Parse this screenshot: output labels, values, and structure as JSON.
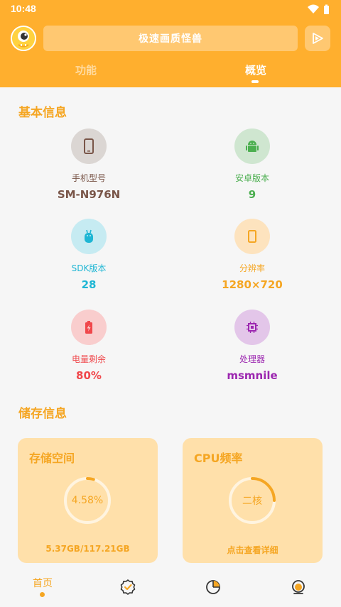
{
  "statusbar": {
    "time": "10:48"
  },
  "header": {
    "title": "极速画质怪兽",
    "tabs": [
      {
        "label": "功能",
        "active": false
      },
      {
        "label": "概览",
        "active": true
      }
    ]
  },
  "basic_info": {
    "title": "基本信息",
    "items": [
      {
        "label": "手机型号",
        "value": "SM-N976N",
        "color": "#795548",
        "bg": "#DBD6D3",
        "icon": "phone-icon"
      },
      {
        "label": "安卓版本",
        "value": "9",
        "color": "#4CAF50",
        "bg": "#CFE6D0",
        "icon": "android-icon"
      },
      {
        "label": "SDK版本",
        "value": "28",
        "color": "#1EB6D4",
        "bg": "#C6EBF2",
        "icon": "sdk-icon"
      },
      {
        "label": "分辨率",
        "value": "1280×720",
        "color": "#F5A623",
        "bg": "#FDE3BE",
        "icon": "screen-icon"
      },
      {
        "label": "电量剩余",
        "value": "80%",
        "color": "#F0474B",
        "bg": "#F9CDCD",
        "icon": "battery-icon"
      },
      {
        "label": "处理器",
        "value": "msmnile",
        "color": "#9C27B0",
        "bg": "#E3C6E9",
        "icon": "chip-icon"
      }
    ]
  },
  "storage_info": {
    "title": "储存信息",
    "storage_card": {
      "title": "存储空间",
      "percent_text": "4.58%",
      "percent": 4.58,
      "footer": "5.37GB/117.21GB"
    },
    "cpu_card": {
      "title": "CPU频率",
      "center_text": "二核",
      "footer": "点击查看详细"
    }
  },
  "bottom_nav": {
    "items": [
      {
        "label": "首页",
        "active": true,
        "icon": "home"
      },
      {
        "label": "",
        "icon": "badge-check-icon"
      },
      {
        "label": "",
        "icon": "pie-chart-icon"
      },
      {
        "label": "",
        "icon": "profile-icon"
      }
    ]
  },
  "colors": {
    "accent": "#FFAF2E",
    "accent_text": "#F5A623",
    "card_bg": "#FFE0AA"
  }
}
